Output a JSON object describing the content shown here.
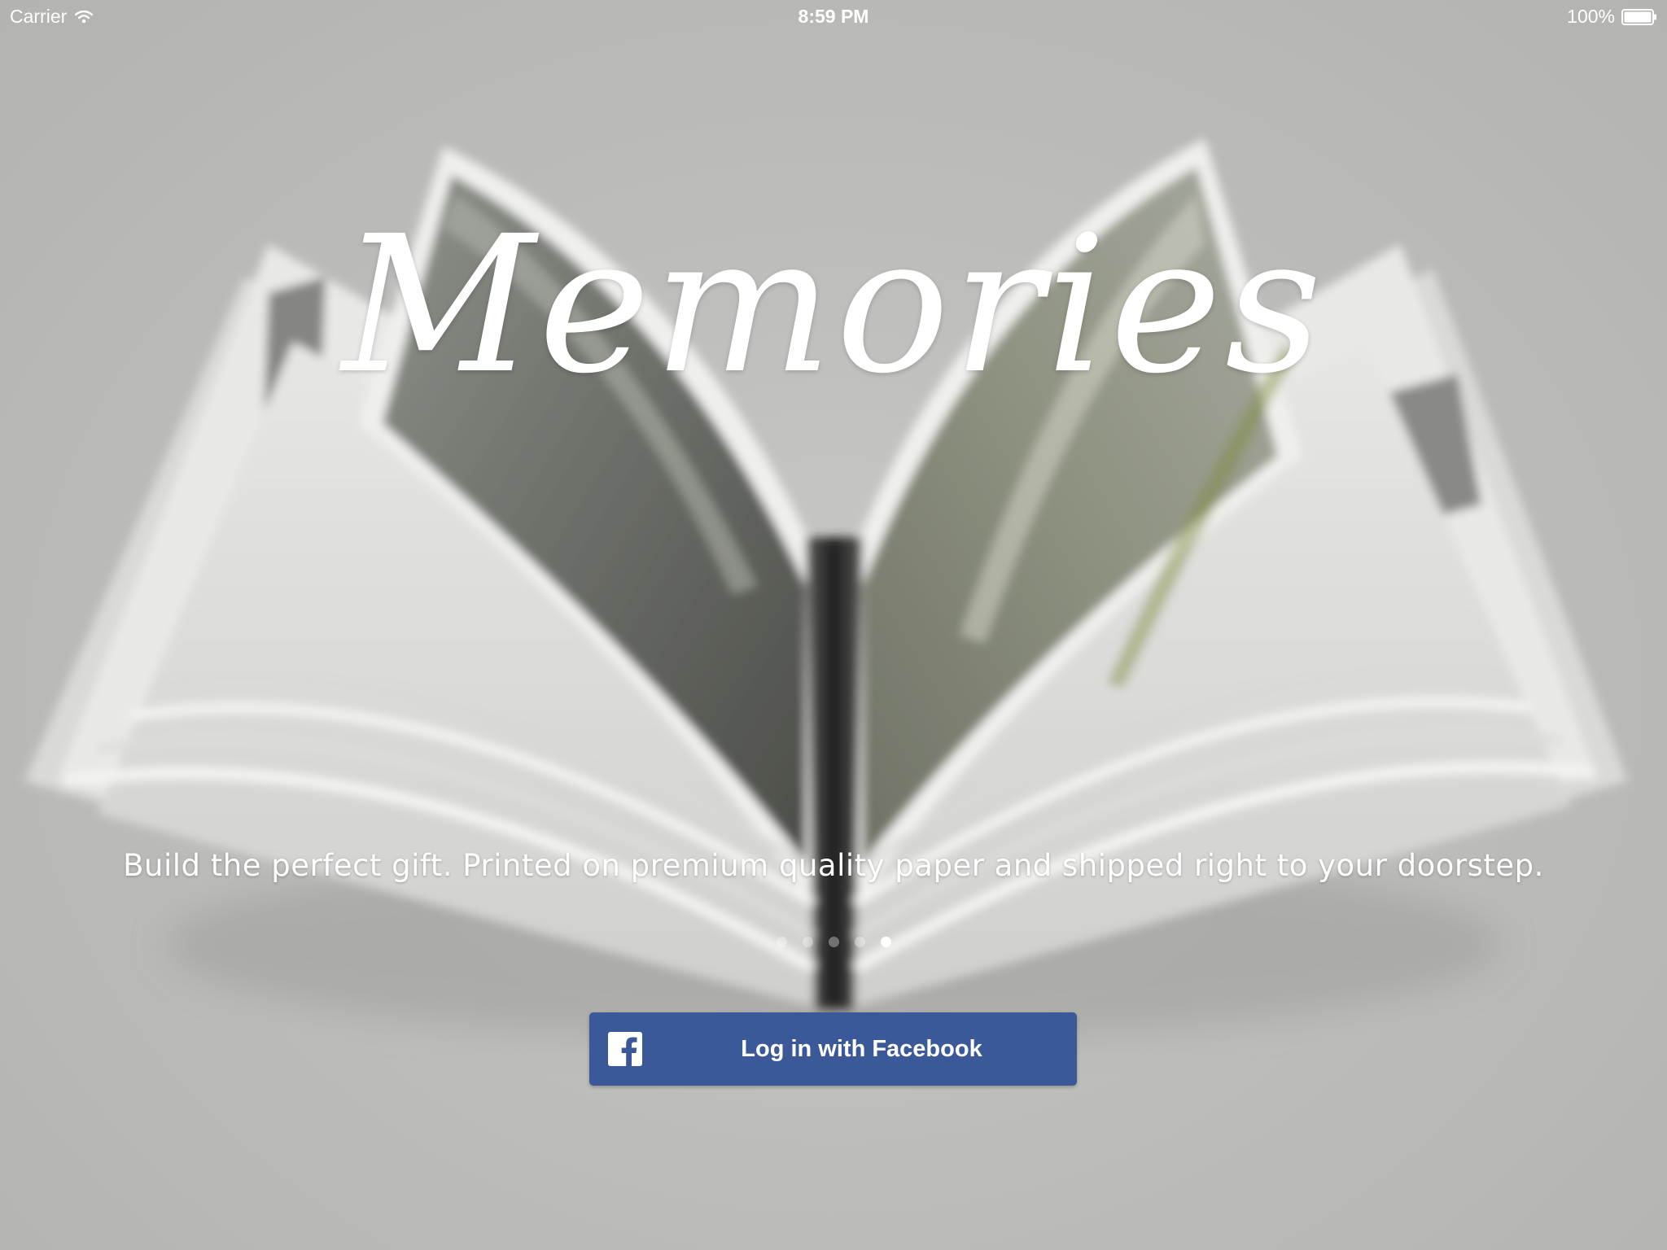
{
  "status_bar": {
    "carrier": "Carrier",
    "time": "8:59 PM",
    "battery": "100%",
    "wifi_icon": "wifi-icon",
    "battery_icon": "battery-icon"
  },
  "hero": {
    "title": "Memories",
    "tagline": "Build the perfect gift. Printed on premium quality paper and shipped right to your doorstep.",
    "image_icon": "open-photo-book"
  },
  "pager": {
    "page_count": 5,
    "current_page": 5
  },
  "login": {
    "button_label": "Log in with Facebook",
    "icon": "facebook-icon",
    "color": "#3b5998"
  }
}
